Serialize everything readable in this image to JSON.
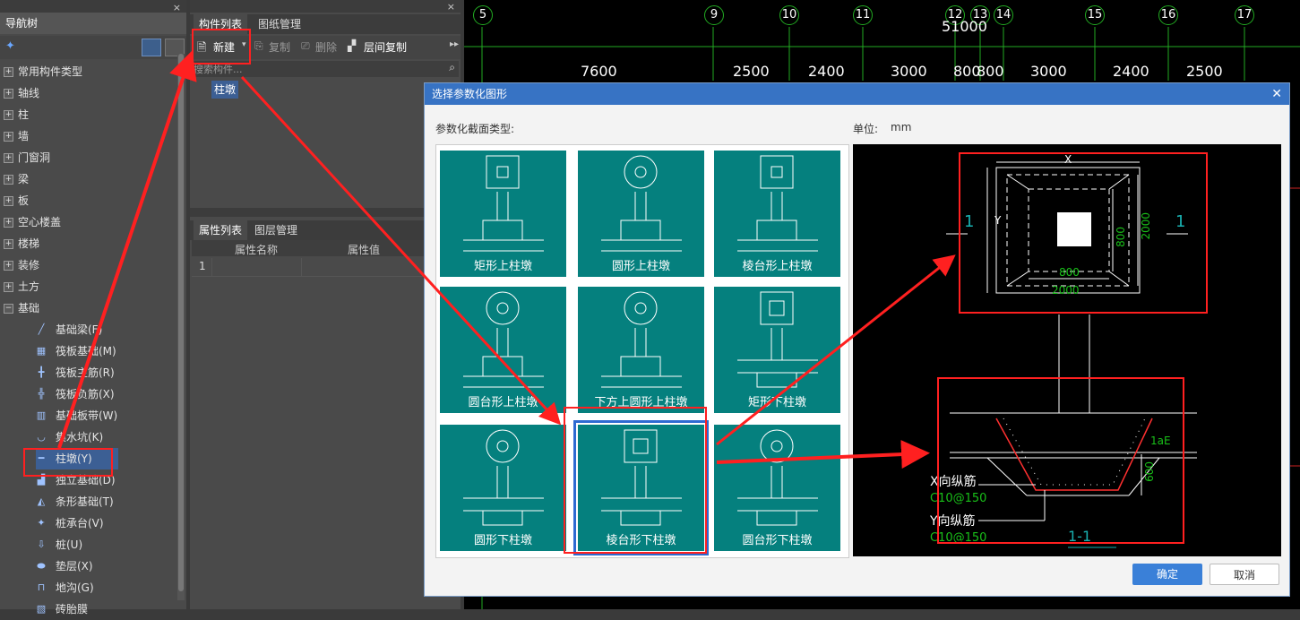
{
  "nav": {
    "title": "导航树",
    "close": "×",
    "items": [
      {
        "label": "常用构件类型",
        "pm": "+"
      },
      {
        "label": "轴线",
        "pm": "+"
      },
      {
        "label": "柱",
        "pm": "+"
      },
      {
        "label": "墙",
        "pm": "+"
      },
      {
        "label": "门窗洞",
        "pm": "+"
      },
      {
        "label": "梁",
        "pm": "+"
      },
      {
        "label": "板",
        "pm": "+"
      },
      {
        "label": "空心楼盖",
        "pm": "+"
      },
      {
        "label": "楼梯",
        "pm": "+"
      },
      {
        "label": "装修",
        "pm": "+"
      },
      {
        "label": "土方",
        "pm": "+"
      },
      {
        "label": "基础",
        "pm": "−"
      }
    ],
    "subitems": [
      {
        "label": "基础梁(F)",
        "icon": "beam-icon"
      },
      {
        "label": "筏板基础(M)",
        "icon": "raft-icon"
      },
      {
        "label": "筏板主筋(R)",
        "icon": "rebar-icon"
      },
      {
        "label": "筏板负筋(X)",
        "icon": "neg-rebar-icon"
      },
      {
        "label": "基础板带(W)",
        "icon": "strip-icon"
      },
      {
        "label": "集水坑(K)",
        "icon": "pit-icon"
      },
      {
        "label": "柱墩(Y)",
        "icon": "pier-icon"
      },
      {
        "label": "独立基础(D)",
        "icon": "footing-icon"
      },
      {
        "label": "条形基础(T)",
        "icon": "strip-footing-icon"
      },
      {
        "label": "桩承台(V)",
        "icon": "pile-cap-icon"
      },
      {
        "label": "桩(U)",
        "icon": "pile-icon"
      },
      {
        "label": "垫层(X)",
        "icon": "cushion-icon"
      },
      {
        "label": "地沟(G)",
        "icon": "trench-icon"
      },
      {
        "label": "砖胎膜",
        "icon": "brick-icon"
      }
    ]
  },
  "comp": {
    "tabs": [
      "构件列表",
      "图纸管理"
    ],
    "new_label": "新建",
    "copy_label": "复制",
    "delete_label": "删除",
    "floor_copy_label": "层间复制",
    "search_placeholder": "搜索构件...",
    "selected_item": "柱墩"
  },
  "attr": {
    "tabs": [
      "属性列表",
      "图层管理"
    ],
    "col_name": "属性名称",
    "col_value": "属性值",
    "row1": "1"
  },
  "draw": {
    "axes": [
      "5",
      "9",
      "10",
      "11",
      "12",
      "13",
      "14",
      "15",
      "16",
      "17"
    ],
    "total_dim": "51000",
    "dims": [
      "7600",
      "2500",
      "2400",
      "3000",
      "800",
      "800",
      "3000",
      "2400",
      "2500"
    ]
  },
  "dialog": {
    "title": "选择参数化图形",
    "section_label": "参数化截面类型:",
    "unit_label": "单位:",
    "unit_value": "mm",
    "shapes": [
      "矩形上柱墩",
      "圆形上柱墩",
      "棱台形上柱墩",
      "圆台形上柱墩",
      "下方上圆形上柱墩",
      "矩形下柱墩",
      "圆形下柱墩",
      "棱台形下柱墩",
      "圆台形下柱墩"
    ],
    "ok_label": "确定",
    "cancel_label": "取消",
    "preview": {
      "x_label": "X",
      "y_label": "Y",
      "section_mark": "1",
      "dim_800": "800",
      "dim_2000": "2000",
      "dim_600": "600",
      "lae": "1aE",
      "x_rebar": "X向纵筋",
      "x_rebar_spec": "C10@150",
      "y_rebar": "Y向纵筋",
      "y_rebar_spec": "C10@150",
      "section_name": "1-1"
    }
  }
}
